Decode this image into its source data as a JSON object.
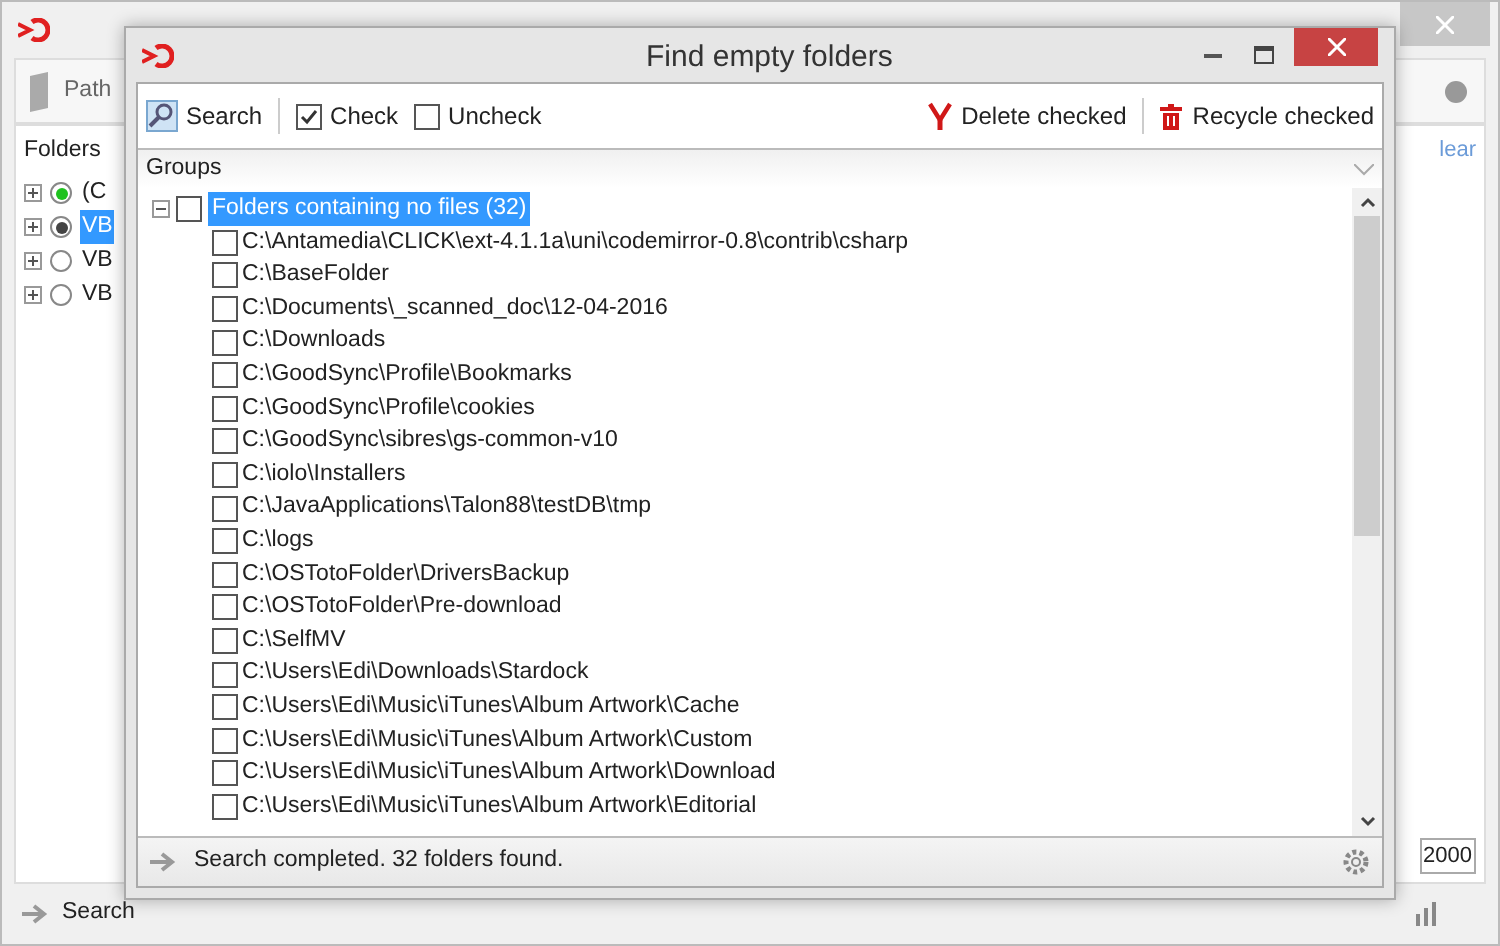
{
  "background_window": {
    "toolbar_button": "Path",
    "folders_header": "Folders",
    "folders": [
      {
        "label": "(C",
        "kind": "green",
        "selected": false
      },
      {
        "label": "VB",
        "kind": "dark",
        "selected": true
      },
      {
        "label": "VB",
        "kind": "empty",
        "selected": false
      },
      {
        "label": "VB",
        "kind": "empty",
        "selected": false
      }
    ],
    "clear_link": "lear",
    "spinner_value": "2000",
    "status": "Search"
  },
  "dialog": {
    "title": "Find empty folders",
    "toolbar_left": [
      {
        "label": "Search",
        "kind": "search"
      },
      {
        "label": "Check",
        "kind": "check"
      },
      {
        "label": "Uncheck",
        "kind": "uncheck"
      }
    ],
    "toolbar_right": [
      {
        "label": "Delete checked",
        "kind": "delete"
      },
      {
        "label": "Recycle checked",
        "kind": "recycle"
      }
    ],
    "groups_header": "Groups",
    "group": {
      "label": "Folders containing no files (32)",
      "checked": false,
      "expanded": true,
      "selected": true,
      "children": [
        {
          "path": "C:\\Antamedia\\CLICK\\ext-4.1.1a\\uni\\codemirror-0.8\\contrib\\csharp",
          "checked": false
        },
        {
          "path": "C:\\BaseFolder",
          "checked": false
        },
        {
          "path": "C:\\Documents\\_scanned_doc\\12-04-2016",
          "checked": false
        },
        {
          "path": "C:\\Downloads",
          "checked": false
        },
        {
          "path": "C:\\GoodSync\\Profile\\Bookmarks",
          "checked": false
        },
        {
          "path": "C:\\GoodSync\\Profile\\cookies",
          "checked": false
        },
        {
          "path": "C:\\GoodSync\\sibres\\gs-common-v10",
          "checked": false
        },
        {
          "path": "C:\\iolo\\Installers",
          "checked": false
        },
        {
          "path": "C:\\JavaApplications\\Talon88\\testDB\\tmp",
          "checked": false
        },
        {
          "path": "C:\\logs",
          "checked": false
        },
        {
          "path": "C:\\OSTotoFolder\\DriversBackup",
          "checked": false
        },
        {
          "path": "C:\\OSTotoFolder\\Pre-download",
          "checked": false
        },
        {
          "path": "C:\\SelfMV",
          "checked": false
        },
        {
          "path": "C:\\Users\\Edi\\Downloads\\Stardock",
          "checked": false
        },
        {
          "path": "C:\\Users\\Edi\\Music\\iTunes\\Album Artwork\\Cache",
          "checked": false
        },
        {
          "path": "C:\\Users\\Edi\\Music\\iTunes\\Album Artwork\\Custom",
          "checked": false
        },
        {
          "path": "C:\\Users\\Edi\\Music\\iTunes\\Album Artwork\\Download",
          "checked": false
        },
        {
          "path": "C:\\Users\\Edi\\Music\\iTunes\\Album Artwork\\Editorial",
          "checked": false
        }
      ]
    },
    "status": "Search completed. 32 folders found."
  }
}
